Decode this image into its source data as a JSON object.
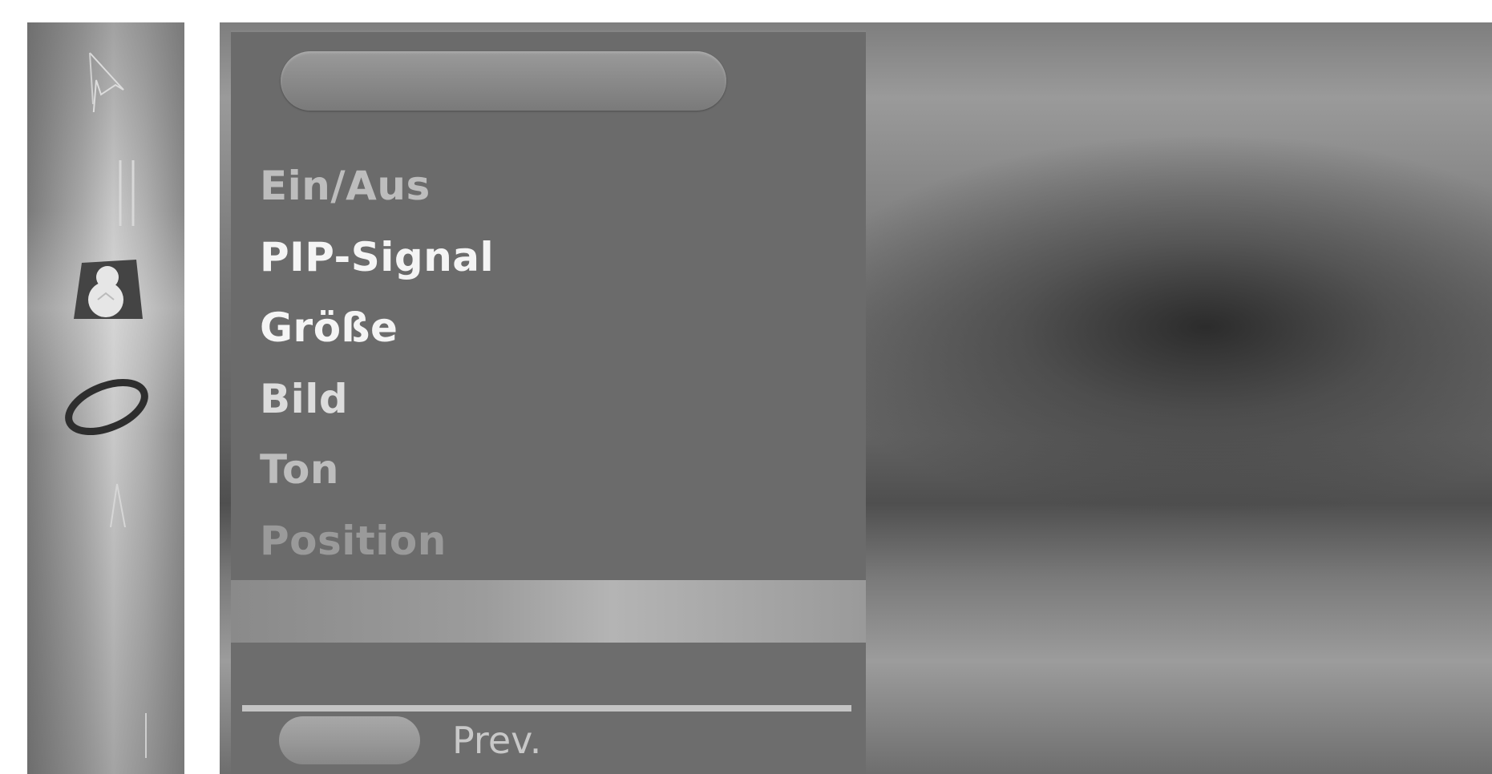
{
  "icon_strip": {
    "icons": [
      {
        "name": "picture-icon"
      },
      {
        "name": "audio-icon"
      },
      {
        "name": "timer-icon"
      },
      {
        "name": "setup-icon"
      },
      {
        "name": "lock-icon"
      }
    ]
  },
  "menu": {
    "title": "",
    "items": [
      {
        "label": "Ein/Aus",
        "state": "dim"
      },
      {
        "label": "PIP-Signal",
        "state": "bright"
      },
      {
        "label": "Größe",
        "state": "bright"
      },
      {
        "label": "Bild",
        "state": "mid"
      },
      {
        "label": "Ton",
        "state": "dim"
      },
      {
        "label": "Position",
        "state": "faint"
      }
    ]
  },
  "footer": {
    "prev_label": "Prev."
  }
}
